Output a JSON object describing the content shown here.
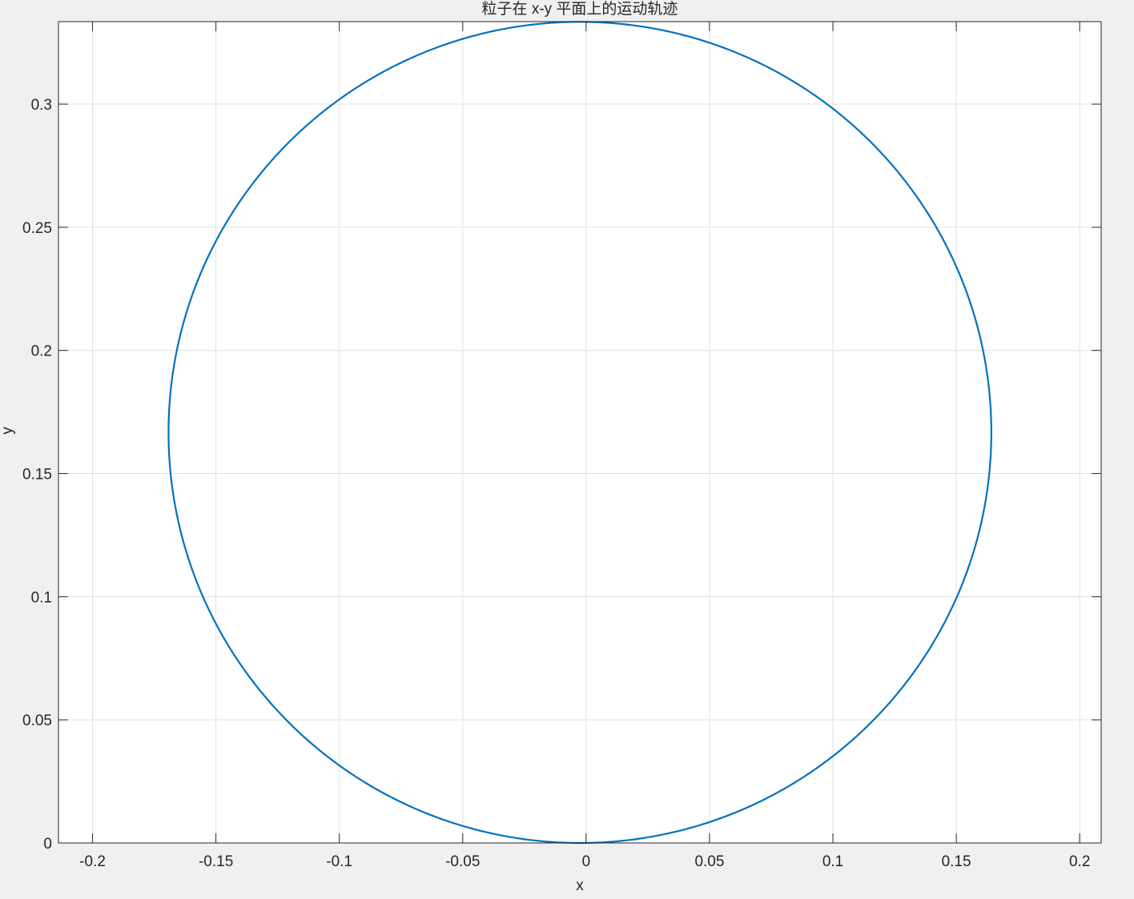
{
  "figure": {
    "background": "#f0f0f0",
    "axes_background": "#ffffff",
    "line_color": "#0072bd",
    "grid_color": "#e1e1e1",
    "text_color": "#262626"
  },
  "chart_data": {
    "type": "line",
    "title": "粒子在 x-y 平面上的运动轨迹",
    "xlabel": "x",
    "ylabel": "y",
    "xlim": [
      -0.2138,
      0.2087
    ],
    "ylim": [
      0,
      0.3335
    ],
    "grid": true,
    "box": true,
    "xticks": [
      -0.2,
      -0.15,
      -0.1,
      -0.05,
      0,
      0.05,
      0.1,
      0.15,
      0.2
    ],
    "xtick_labels": [
      "-0.2",
      "-0.15",
      "-0.1",
      "-0.05",
      "0",
      "0.05",
      "0.1",
      "0.15",
      "0.2"
    ],
    "yticks": [
      0,
      0.05,
      0.1,
      0.15,
      0.2,
      0.25,
      0.3
    ],
    "ytick_labels": [
      "0",
      "0.05",
      "0.1",
      "0.15",
      "0.2",
      "0.25",
      "0.3"
    ],
    "series": [
      {
        "shape": "circle",
        "center": [
          -0.0025,
          0.1667
        ],
        "radius": 0.1667,
        "points": 720
      }
    ]
  }
}
